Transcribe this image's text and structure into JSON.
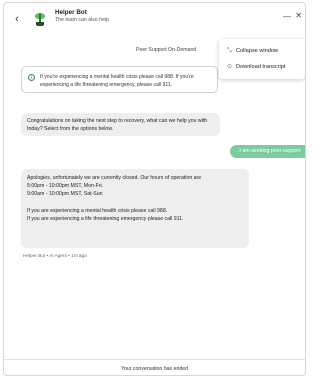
{
  "header": {
    "back_icon": "chevron-left-icon",
    "avatar_icon": "plant-bot-avatar",
    "bot_name": "Helper Bot",
    "bot_subtitle": "The team can also help",
    "minimize_icon": "minimize-icon",
    "close_icon": "close-icon",
    "minimize_glyph": "—",
    "close_glyph": "✕",
    "back_glyph": "‹"
  },
  "status": "Peer Support On-Demand",
  "menu": {
    "items": [
      {
        "icon": "collapse-icon",
        "glyph": "⤡",
        "label": "Collapse window"
      },
      {
        "icon": "download-icon",
        "glyph": "⊙",
        "label": "Download transcript"
      }
    ]
  },
  "banner": {
    "icon": "info-icon",
    "text": "If you're experiencing a mental health crisis please call 988. If you're experiencing a life threatening emergency, please call 911."
  },
  "messages": {
    "bot_1": "Congratulations on taking the next step to recovery, what can we help you with today? Select from the options below.",
    "user_1": "I am seeking peer support",
    "bot_2": {
      "line1": "Apologies, unfortunately we are currently closed. Our hours of operation are",
      "line2": "5:00pm - 10:00pm MST, Mon-Fri.",
      "line3": "9:00am - 10:00pm MST, Sat-Sun",
      "line4": "If you are experiencing a mental health crisis please call 988.",
      "line5": "If you are experiencing a life threatening emergency please call 911."
    },
    "meta": "Helper Bot • AI Agent • 1m ago"
  },
  "footer": {
    "ended_text": "Your conversation has ended"
  },
  "colors": {
    "accent_green": "#7dcca0",
    "icon_green": "#3b8a5e",
    "bubble_grey": "#eeeeee"
  }
}
